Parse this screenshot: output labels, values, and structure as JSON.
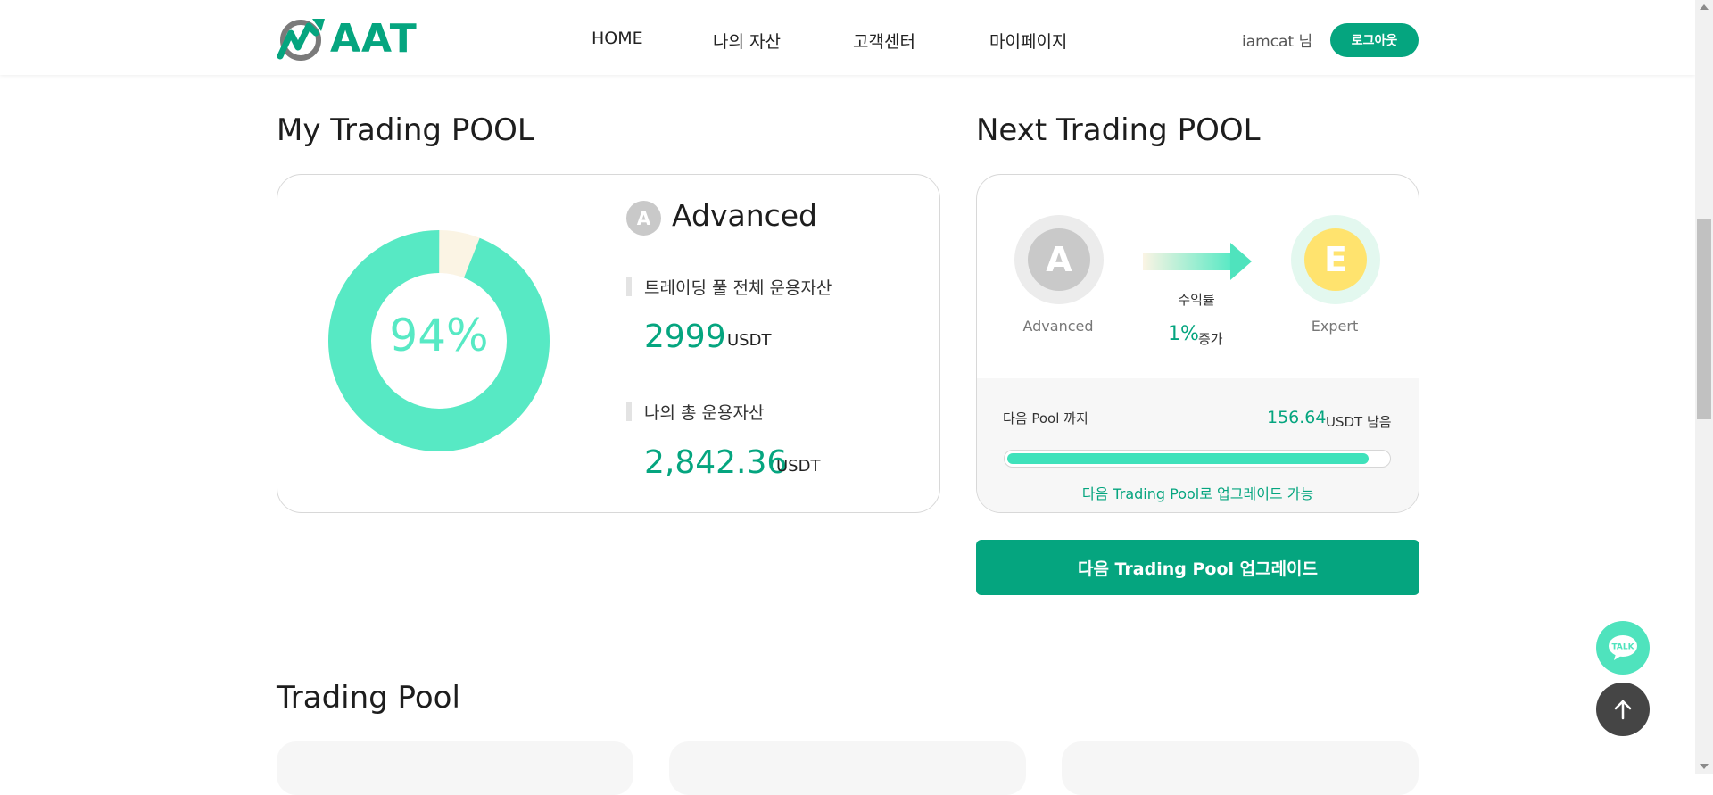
{
  "header": {
    "logo_text": "AAT",
    "nav": [
      "HOME",
      "나의 자산",
      "고객센터",
      "마이페이지"
    ],
    "user_name": "iamcat 님",
    "logout_label": "로그아웃"
  },
  "my_pool": {
    "title": "My Trading POOL",
    "percent_label": "94%",
    "percent_value": 94,
    "tier_letter": "A",
    "tier_name": "Advanced",
    "total_label": "트레이딩 풀 전체 운용자산",
    "total_value": "2999",
    "total_unit": "USDT",
    "mine_label": "나의 총 운용자산",
    "mine_value": "2,842.36",
    "mine_unit": "USDT"
  },
  "next_pool": {
    "title": "Next Trading POOL",
    "from_letter": "A",
    "from_name": "Advanced",
    "to_letter": "E",
    "to_name": "Expert",
    "rate_label": "수익률",
    "rate_value": "1%",
    "rate_suffix": "증가",
    "until_label": "다음 Pool 까지",
    "remain_value": "156.64",
    "remain_unit": "USDT 남음",
    "progress_fraction": 0.95,
    "progress_note": "다음 Trading Pool로 업그레이드 가능"
  },
  "upgrade_button_label": "다음 Trading Pool 업그레이드",
  "trading_pool": {
    "title": "Trading Pool"
  },
  "floating": {
    "talk_label": "TALK"
  },
  "colors": {
    "brand": "#05a57f",
    "mint": "#57e9c4",
    "donut_rest": "#fbf4e4",
    "expert_yellow": "#ffe36e"
  }
}
